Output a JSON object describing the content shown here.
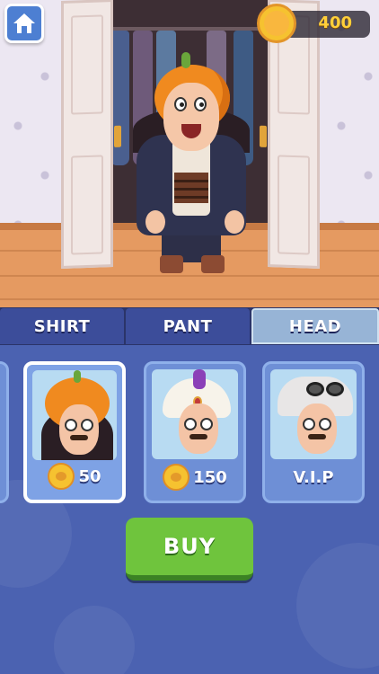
{
  "hud": {
    "coins": "400",
    "coin_icon": "gold-coin-face-icon",
    "home_icon": "home-icon"
  },
  "tabs": [
    {
      "label": "SHIRT",
      "active": false
    },
    {
      "label": "PANT",
      "active": false
    },
    {
      "label": "HEAD",
      "active": true
    }
  ],
  "items": [
    {
      "name": "pumpkin-head",
      "price": "50",
      "selected": true
    },
    {
      "name": "turban-head",
      "price": "150",
      "selected": false
    },
    {
      "name": "goggles-head",
      "price": "V.I.P",
      "selected": false
    }
  ],
  "buy_label": "BUY",
  "colors": {
    "tab_active": "#97b4d6",
    "tab_inactive": "#3c4d9a",
    "buy_green": "#6fc43d",
    "panel_blue": "#4b62b1",
    "coin_gold": "#ffcf3a"
  }
}
